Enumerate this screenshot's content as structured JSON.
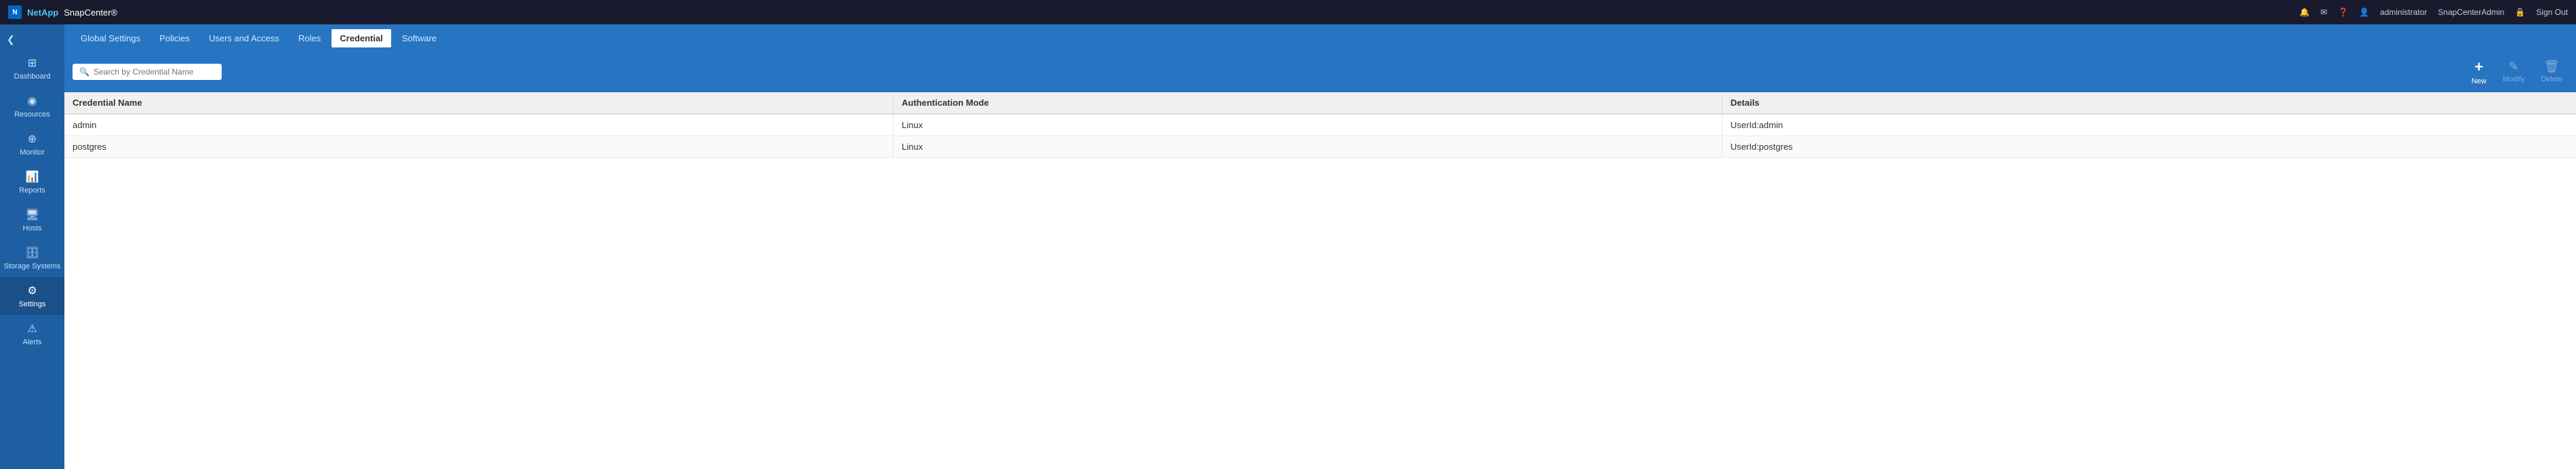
{
  "app": {
    "name": "NetApp",
    "product": "SnapCenter®"
  },
  "header": {
    "icons": {
      "bell": "🔔",
      "mail": "✉",
      "help": "❓"
    },
    "user": "administrator",
    "admin": "SnapCenterAdmin",
    "signout": "Sign Out"
  },
  "sidebar": {
    "collapse_icon": "❮",
    "items": [
      {
        "id": "dashboard",
        "label": "Dashboard",
        "icon": "⊞",
        "active": false
      },
      {
        "id": "resources",
        "label": "Resources",
        "icon": "◉",
        "active": false
      },
      {
        "id": "monitor",
        "label": "Monitor",
        "icon": "⊕",
        "active": false
      },
      {
        "id": "reports",
        "label": "Reports",
        "icon": "📊",
        "active": false
      },
      {
        "id": "hosts",
        "label": "Hosts",
        "icon": "🖥",
        "active": false
      },
      {
        "id": "storage-systems",
        "label": "Storage Systems",
        "icon": "🗄",
        "active": false
      },
      {
        "id": "settings",
        "label": "Settings",
        "icon": "⚙",
        "active": true
      },
      {
        "id": "alerts",
        "label": "Alerts",
        "icon": "⚠",
        "active": false
      }
    ]
  },
  "subnav": {
    "tabs": [
      {
        "id": "global-settings",
        "label": "Global Settings",
        "active": false
      },
      {
        "id": "policies",
        "label": "Policies",
        "active": false
      },
      {
        "id": "users-and-access",
        "label": "Users and Access",
        "active": false
      },
      {
        "id": "roles",
        "label": "Roles",
        "active": false
      },
      {
        "id": "credential",
        "label": "Credential",
        "active": true
      },
      {
        "id": "software",
        "label": "Software",
        "active": false
      }
    ]
  },
  "toolbar": {
    "search_placeholder": "Search by Credential Name",
    "search_value": "",
    "actions": [
      {
        "id": "new",
        "label": "New",
        "icon": "+",
        "disabled": false
      },
      {
        "id": "modify",
        "label": "Modify",
        "icon": "✎",
        "disabled": true
      },
      {
        "id": "delete",
        "label": "Delete",
        "icon": "🗑",
        "disabled": true
      }
    ]
  },
  "table": {
    "columns": [
      {
        "id": "credential-name",
        "label": "Credential Name"
      },
      {
        "id": "authentication-mode",
        "label": "Authentication Mode"
      },
      {
        "id": "details",
        "label": "Details"
      }
    ],
    "rows": [
      {
        "credential_name": "admin",
        "auth_mode": "Linux",
        "details": "UserId:admin"
      },
      {
        "credential_name": "postgres",
        "auth_mode": "Linux",
        "details": "UserId:postgres"
      }
    ]
  }
}
